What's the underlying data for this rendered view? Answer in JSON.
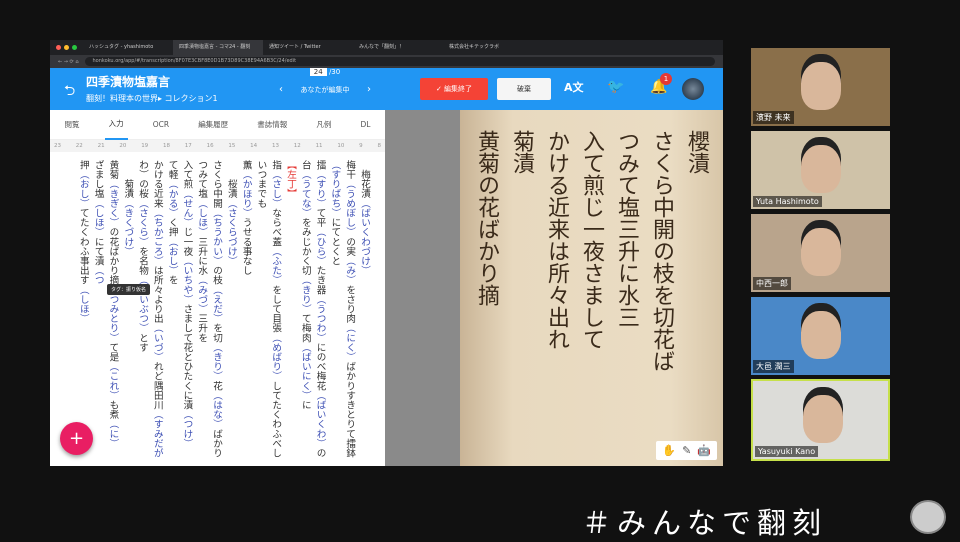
{
  "browser": {
    "tabs": [
      "ハッシュタグ - yhashimoto",
      "四季漬物塩嘉言 - コマ24 - 翻刻",
      "通知ツイート / Twitter",
      "みんなで「翻刻」！",
      "株式会社キテックラボ"
    ],
    "url": "honkoku.org/app/#/transcription/8F07E3CBF8E0D1B73D89C38E94A6B3C/24/edit"
  },
  "header": {
    "title": "四季漬物塩嘉言",
    "breadcrumb": "翻刻！料理本の世界▸ コレクション1",
    "page": "24",
    "total": "/30",
    "status": "あなたが編集中",
    "end_edit": "✓ 編集終了",
    "discard": "破棄",
    "translate": "A文",
    "notification_count": "1"
  },
  "tabs": [
    "閲覧",
    "入力",
    "OCR",
    "編集履歴",
    "書誌情報",
    "凡例",
    "DL"
  ],
  "active_tab": "入力",
  "line_numbers": [
    "8",
    "9",
    "10",
    "11",
    "12",
    "13",
    "14",
    "15",
    "16",
    "17",
    "18",
    "19",
    "20",
    "21",
    "22",
    "23"
  ],
  "lines": [
    "　梅花漬（ばいくわづけ）",
    "梅干（うめぼし）の実（み）をさり肉（にく）ばかりすきとりて擂鉢",
    "（すりばち）にてとくと",
    "擂（すり）て平（ひら）たき器（うつわ）にのべ梅花（ばいくわ）の",
    "台（うてな）をみじかく切（きり）て梅肉（ばいにく）に",
    "【左丁】",
    "指（さし）ならべ蓋（ふた）をして目張（めばり）してたくわふべし",
    "いつまでも",
    "薫（かほり）うせる事なし",
    "　　桜漬（さくらづけ）",
    "さくら中開（ちうかい）の枝（えだ）を切（きり）花（はな）ばかり",
    "つみて塩（しほ）三升に水（みづ）三升を",
    "入て煎（せん）じ一夜（いちや）さまして花とひたくに漬（つけ）",
    "て軽（かる）く押（おし）を",
    "かける近来（ちかごろ）は所々より出（いづ）れど隅田川（すみだが",
    "わ）の桜（さくら）を名物（めいぶつ）とす",
    "　　菊漬（きくづけ）",
    "黄菊（きぎく）の花ばかり摘（つみとり）て是（これ）も煮（に）",
    "ざまし塩（しほ）にて漬（つ",
    "押（おし）てたくわふ事出す（しほ）"
  ],
  "tooltip": "タグ：振り仮名",
  "add_button": "+",
  "participants": [
    {
      "name": "濱野 未来",
      "bg": "#8a6f4a"
    },
    {
      "name": "Yuta Hashimoto",
      "bg": "#cfc2a8"
    },
    {
      "name": "中西一郎",
      "bg": "#b9a48c"
    },
    {
      "name": "大邑 潤三",
      "bg": "#4a88c8"
    },
    {
      "name": "Yasuyuki Kano",
      "bg": "#dcdcd8"
    }
  ],
  "hashtag": "＃みんなで翻刻",
  "colors": {
    "header": "#2196f3",
    "end_edit": "#f44336",
    "fab": "#e91e63",
    "reading": "#3f51b5",
    "active_speaker": "#c6e04a"
  }
}
